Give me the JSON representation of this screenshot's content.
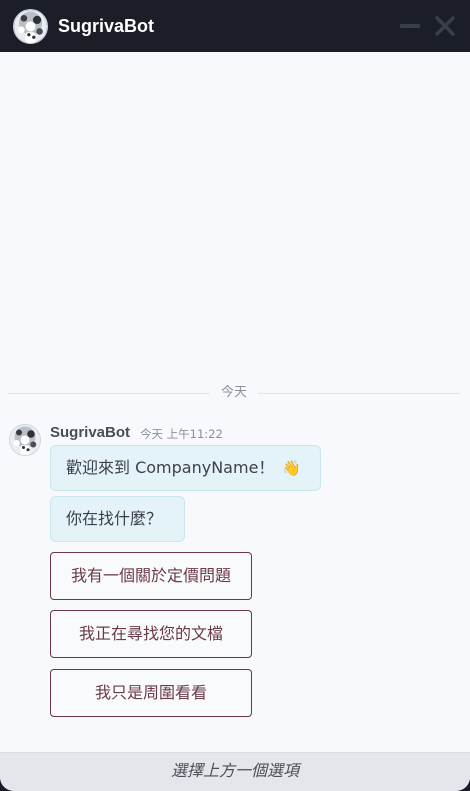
{
  "header": {
    "title": "SugrivaBot",
    "avatar_icon": "bot-avatar-icon",
    "minimize_icon": "minimize-icon",
    "close_icon": "close-icon"
  },
  "conversation": {
    "date_separator": "今天",
    "sender": {
      "name": "SugrivaBot",
      "time": "今天 上午11:22"
    },
    "messages": [
      {
        "text": "歡迎來到 CompanyName！",
        "emoji": "👋"
      },
      {
        "text": "你在找什麼？"
      }
    ],
    "quick_replies": [
      {
        "label": "我有一個關於定價問題"
      },
      {
        "label": "我正在尋找您的文檔"
      },
      {
        "label": "我只是周圍看看"
      }
    ]
  },
  "footer": {
    "hint": "選擇上方一個選項"
  },
  "colors": {
    "header_bg": "#1b1e26",
    "chat_bg": "#f7f9fc",
    "bubble_bg": "#e3f3f7",
    "option_border": "#6e3448",
    "footer_bg": "#e4e6eb"
  }
}
